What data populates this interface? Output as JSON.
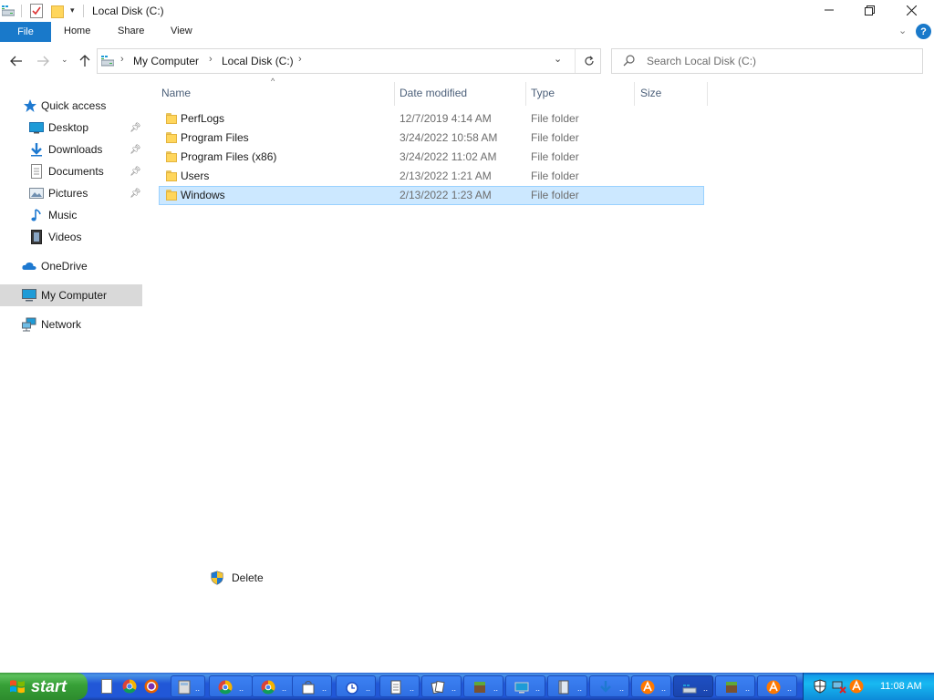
{
  "window": {
    "title": "Local Disk (C:)"
  },
  "ribbon": {
    "tabs": [
      "File",
      "Home",
      "Share",
      "View"
    ]
  },
  "address": {
    "crumbs": [
      "My Computer",
      "Local Disk (C:)"
    ]
  },
  "search": {
    "placeholder": "Search Local Disk (C:)"
  },
  "navpane": {
    "quick_access": "Quick access",
    "pinned": [
      {
        "label": "Desktop",
        "icon": "desktop-icon"
      },
      {
        "label": "Downloads",
        "icon": "downloads-icon"
      },
      {
        "label": "Documents",
        "icon": "documents-icon"
      },
      {
        "label": "Pictures",
        "icon": "pictures-icon"
      }
    ],
    "unpinned": [
      {
        "label": "Music",
        "icon": "music-icon"
      },
      {
        "label": "Videos",
        "icon": "videos-icon"
      }
    ],
    "onedrive": "OneDrive",
    "my_computer": "My Computer",
    "network": "Network"
  },
  "list": {
    "columns": [
      "Name",
      "Date modified",
      "Type",
      "Size"
    ],
    "rows": [
      {
        "name": "PerfLogs",
        "date": "12/7/2019 4:14 AM",
        "type": "File folder",
        "size": ""
      },
      {
        "name": "Program Files",
        "date": "3/24/2022 10:58 AM",
        "type": "File folder",
        "size": ""
      },
      {
        "name": "Program Files (x86)",
        "date": "3/24/2022 11:02 AM",
        "type": "File folder",
        "size": ""
      },
      {
        "name": "Users",
        "date": "2/13/2022 1:21 AM",
        "type": "File folder",
        "size": ""
      },
      {
        "name": "Windows",
        "date": "2/13/2022 1:23 AM",
        "type": "File folder",
        "size": "",
        "selected": true
      }
    ]
  },
  "floating": {
    "delete_label": "Delete"
  },
  "taskbar": {
    "start_label": "start",
    "time": "11:08 AM",
    "accent": "#2157d7",
    "start_color": "#37a037"
  },
  "colors": {
    "file_tab": "#1979ca",
    "selection": "#cce8ff",
    "selection_border": "#99d1ff",
    "nav_selected": "#d9d9d9"
  }
}
